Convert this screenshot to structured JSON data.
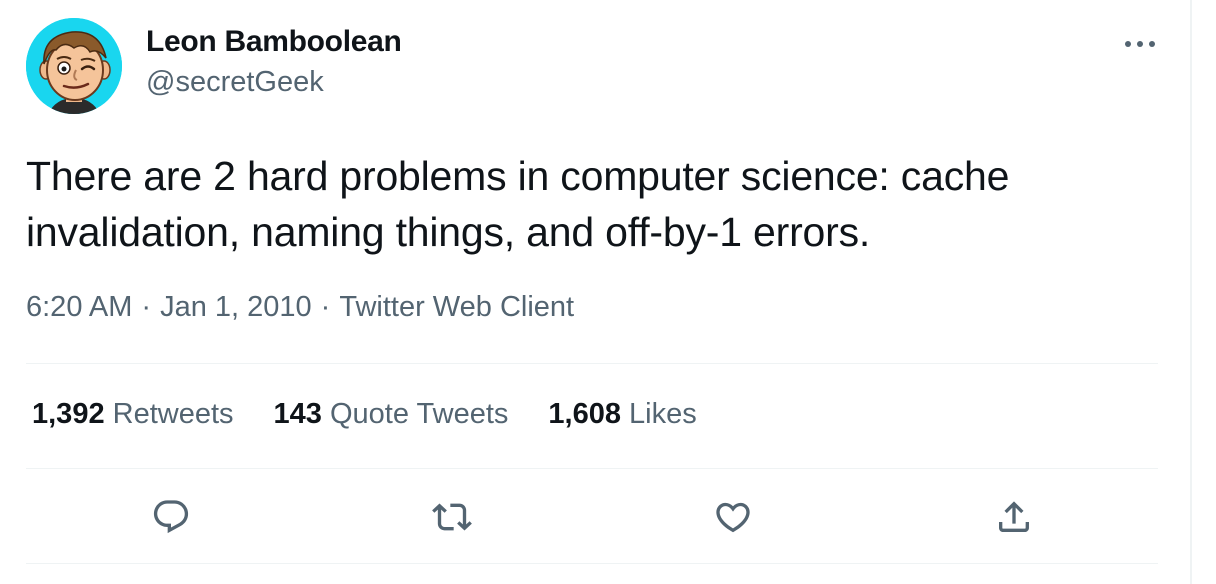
{
  "author": {
    "display_name": "Leon Bamboolean",
    "handle": "@secretGeek"
  },
  "tweet": {
    "text": "There are 2 hard problems in computer science: cache invalidation, naming things, and off-by-1 errors.",
    "time": "6:20 AM",
    "date": "Jan 1, 2010",
    "separator": "·",
    "source": "Twitter Web Client"
  },
  "stats": {
    "retweets": {
      "count": "1,392",
      "label": "Retweets"
    },
    "quote_tweets": {
      "count": "143",
      "label": "Quote Tweets"
    },
    "likes": {
      "count": "1,608",
      "label": "Likes"
    }
  },
  "icons": {
    "more": "more-horizontal-icon",
    "reply": "reply-icon",
    "retweet": "retweet-icon",
    "like": "heart-icon",
    "share": "share-icon"
  },
  "colors": {
    "text": "#0f1419",
    "secondary": "#536471",
    "divider": "#eff3f4",
    "avatar_bg": "#19d6ef"
  }
}
